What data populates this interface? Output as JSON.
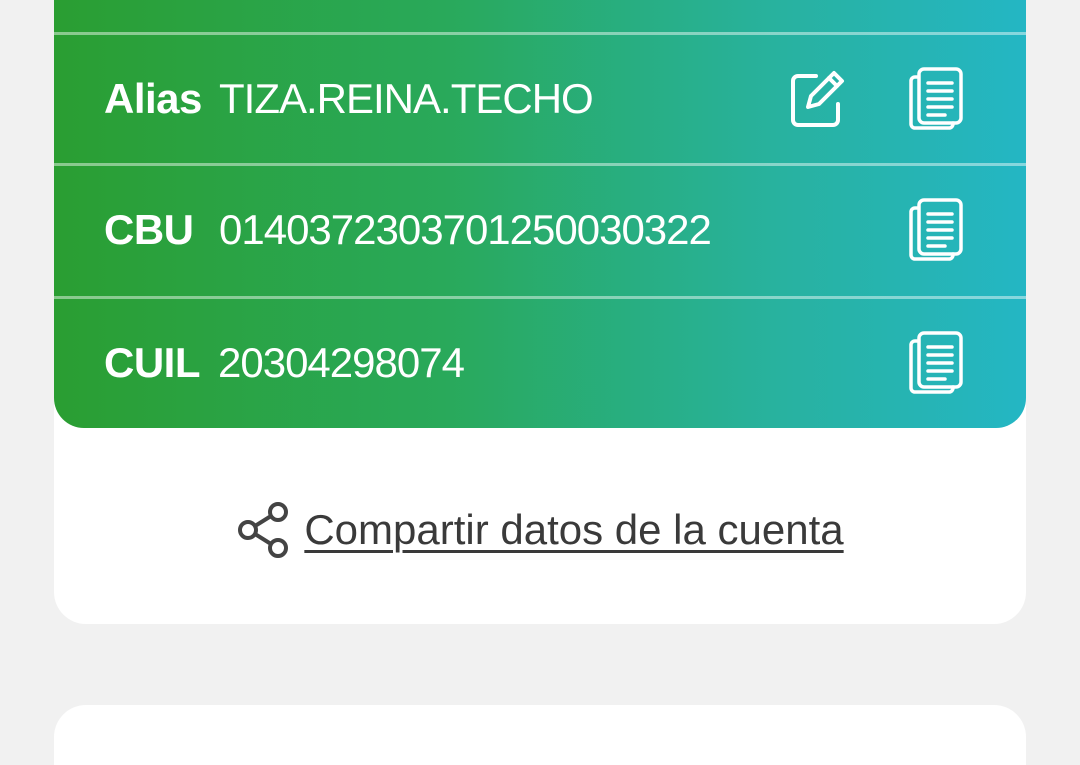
{
  "account": {
    "alias": {
      "label": "Alias",
      "value": "TIZA.REINA.TECHO"
    },
    "cbu": {
      "label": "CBU",
      "value": "0140372303701250030322"
    },
    "cuil": {
      "label": "CUIL",
      "value": "20304298074"
    }
  },
  "share": {
    "label": "Compartir datos de la cuenta"
  },
  "colors": {
    "gradient_start": "#2a9e32",
    "gradient_end": "#24b6c4",
    "background": "#f1f1f1",
    "link_text": "#3a3a3a"
  },
  "icons": [
    "edit-icon",
    "copy-icon",
    "share-icon"
  ]
}
